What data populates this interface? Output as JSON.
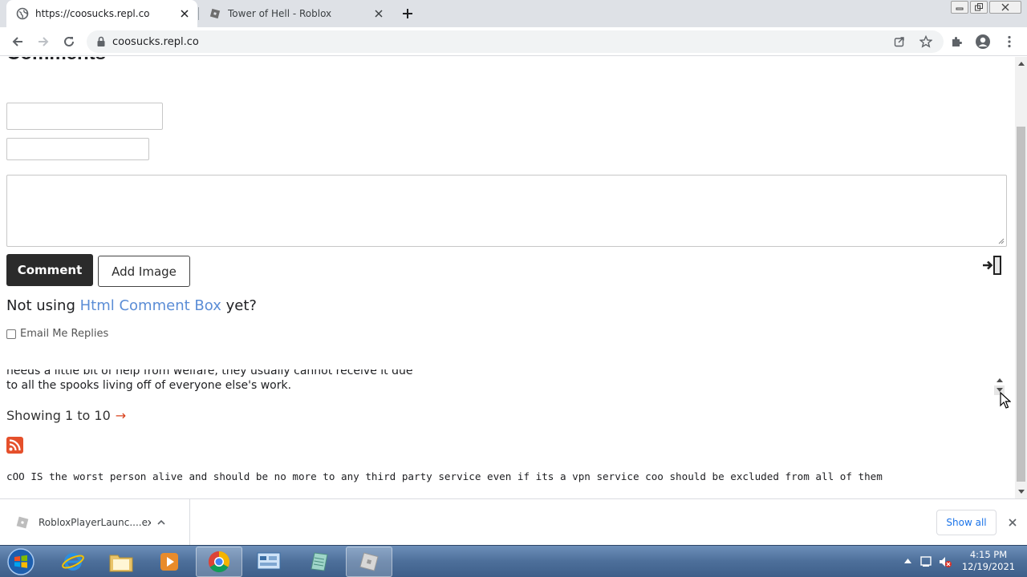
{
  "browser": {
    "tabs": [
      {
        "title": "https://coosucks.repl.co",
        "active": true,
        "icon": "globe-icon"
      },
      {
        "title": "Tower of Hell - Roblox",
        "active": false,
        "icon": "roblox-icon"
      }
    ],
    "address": "coosucks.repl.co"
  },
  "page": {
    "heading": "Comments",
    "form": {
      "name_value": "",
      "email_value": "",
      "comment_value": "",
      "comment_button": "Comment",
      "add_image_button": "Add Image"
    },
    "promo": {
      "prefix": "Not using",
      "link": "Html Comment Box",
      "suffix": " yet?"
    },
    "email_replies_label": "Email Me Replies",
    "comment_excerpt": {
      "line1": "needs a little bit of help from welfare, they usually cannot receive it due",
      "line2": "to all the spooks living off of everyone else's work."
    },
    "pagination": {
      "label": "Showing 1 to 10",
      "arrow": "→"
    },
    "rant": "cOO IS the worst person alive and should be no more to any third party service even if its a vpn service coo should be excluded from all of them"
  },
  "downloads": {
    "file_name": "RobloxPlayerLaunc....exe",
    "show_all": "Show all"
  },
  "taskbar": {
    "time": "4:15 PM",
    "date": "12/19/2021"
  },
  "colors": {
    "link": "#5b8dd6",
    "comment_button_bg": "#2b2b2b",
    "rss": "#e5502b",
    "next_arrow": "#d9431e",
    "show_all": "#1a73e8"
  }
}
